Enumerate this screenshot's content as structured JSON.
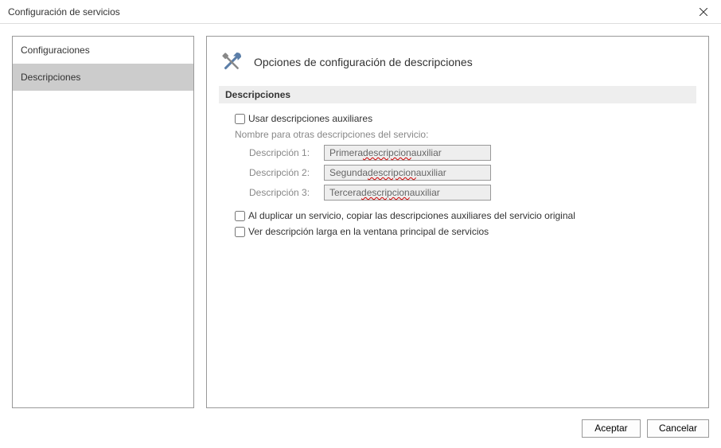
{
  "window": {
    "title": "Configuración de servicios"
  },
  "sidebar": {
    "items": [
      {
        "label": "Configuraciones",
        "selected": false
      },
      {
        "label": "Descripciones",
        "selected": true
      }
    ]
  },
  "panel": {
    "heading": "Opciones de configuración de descripciones",
    "section_title": "Descripciones",
    "use_aux_label": "Usar descripciones auxiliares",
    "use_aux_checked": false,
    "hint": "Nombre para otras descripciones del servicio:",
    "rows": [
      {
        "label": "Descripción 1:",
        "value_pre": "Primera ",
        "value_squig": "descripcion",
        "value_post": " auxiliar"
      },
      {
        "label": "Descripción 2:",
        "value_pre": "Segunda ",
        "value_squig": "descripcion",
        "value_post": " auxiliar"
      },
      {
        "label": "Descripción 3:",
        "value_pre": "Tercera ",
        "value_squig": "descripcion",
        "value_post": " auxiliar"
      }
    ],
    "dup_label": "Al duplicar un servicio, copiar las descripciones auxiliares del servicio original",
    "dup_checked": false,
    "long_label": "Ver descripción larga en la ventana principal de servicios",
    "long_checked": false
  },
  "footer": {
    "accept": "Aceptar",
    "cancel": "Cancelar"
  }
}
